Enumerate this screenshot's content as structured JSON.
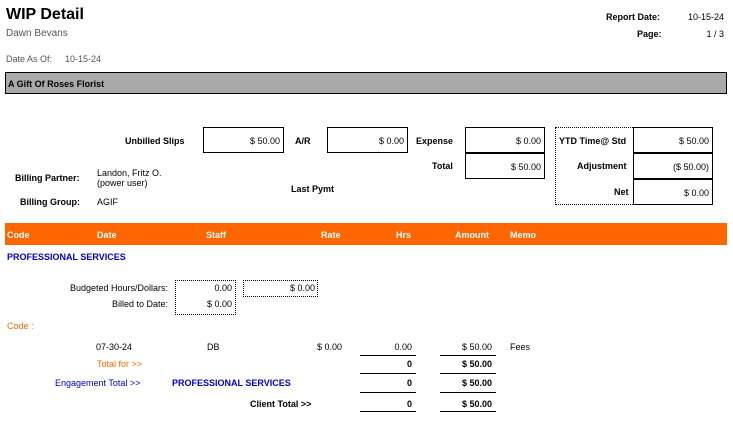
{
  "header": {
    "title": "WIP Detail",
    "user": "Dawn Bevans",
    "report_date_label": "Report Date:",
    "report_date": "10-15-24",
    "page_label": "Page:",
    "page": "1 / 3",
    "date_as_of_label": "Date As Of:",
    "date_as_of": "10-15-24"
  },
  "client": {
    "name": "A Gift Of Roses Florist"
  },
  "summary": {
    "unbilled_slips_label": "Unbilled Slips",
    "unbilled_slips": "$ 50.00",
    "ar_label": "A/R",
    "ar": "$ 0.00",
    "expense_label": "Expense",
    "expense": "$ 0.00",
    "total_label": "Total",
    "total": "$ 50.00",
    "ytd_label": "YTD Time@ Std",
    "ytd": "$ 50.00",
    "adjustment_label": "Adjustment",
    "adjustment": "($ 50.00)",
    "net_label": "Net",
    "net": "$ 0.00",
    "last_pymt_label": "Last Pymt",
    "billing_partner_label": "Billing Partner:",
    "billing_partner_name": "Landon, Fritz O.",
    "billing_partner_role": "(power user)",
    "billing_group_label": "Billing Group:",
    "billing_group": "AGIF"
  },
  "columns": [
    "Code",
    "Date",
    "Staff",
    "Rate",
    "Hrs",
    "Amount",
    "Memo"
  ],
  "section": {
    "title": "PROFESSIONAL SERVICES",
    "budgeted_label": "Budgeted Hours/Dollars:",
    "budgeted_hours": "0.00",
    "budgeted_dollars": "$ 0.00",
    "billed_label": "Billed to Date:",
    "billed": "$ 0.00",
    "code_label": "Code :"
  },
  "entry": {
    "date": "07-30-24",
    "staff": "DB",
    "rate": "$ 0.00",
    "hrs": "0.00",
    "amount": "$ 50.00",
    "memo": "Fees"
  },
  "totals": {
    "total_for_label": "Total for >>",
    "total_for_hrs": "0",
    "total_for_amount": "$ 50.00",
    "engagement_label": "Engagement Total >>",
    "engagement_name": "PROFESSIONAL SERVICES",
    "engagement_hrs": "0",
    "engagement_amount": "$ 50.00",
    "client_total_label": "Client Total >>",
    "client_hrs": "0",
    "client_amount": "$ 50.00"
  }
}
